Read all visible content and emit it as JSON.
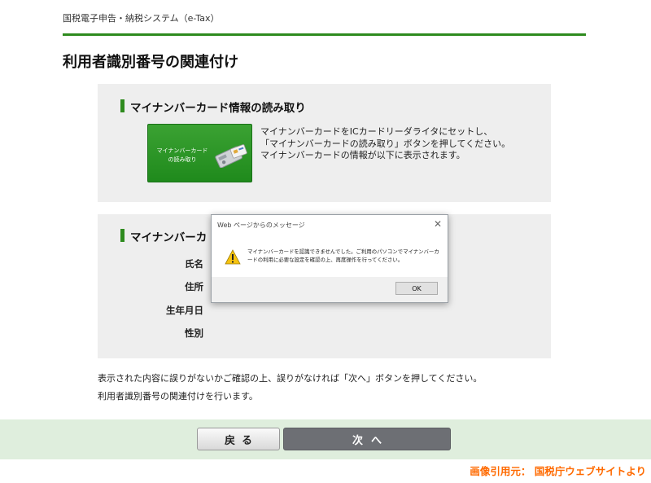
{
  "header": {
    "system_name": "国税電子申告・納税システム（e-Tax）",
    "page_title": "利用者識別番号の関連付け"
  },
  "read_section": {
    "heading": "マイナンバーカード情報の読み取り",
    "button_label_line1": "マイナンバーカード",
    "button_label_line2": "の読み取り",
    "button_icon": "card-reader-icon",
    "description": [
      "マイナンバーカードをICカードリーダライタにセットし、",
      "「マイナンバーカードの読み取り」ボタンを押してください。",
      "マイナンバーカードの情報が以下に表示されます。"
    ]
  },
  "info_section": {
    "heading": "マイナンバーカ",
    "fields": {
      "name": "氏名",
      "address": "住所",
      "birthdate": "生年月日",
      "gender": "性別"
    }
  },
  "notes": {
    "confirm": "表示された内容に誤りがないかご確認の上、誤りがなければ「次へ」ボタンを押してください。",
    "link": "利用者識別番号の関連付けを行います。"
  },
  "footer": {
    "back_label": "戻る",
    "next_label": "次へ"
  },
  "dialog": {
    "title": "Web ページからのメッセージ",
    "close_glyph": "✕",
    "icon": "warning-icon",
    "message_line1": "マイナンバーカードを認識できませんでした。ご利用のパソコンでマイナンバーカ",
    "message_line2": "ードの利用に必要な設定を確認の上、再度操作を行ってください。",
    "ok_label": "OK"
  },
  "credit": "画像引用元： 国税庁ウェブサイトより",
  "colors": {
    "accent_green": "#2e8b1e",
    "button_green": "#1f8a1c",
    "next_button_gray": "#6d6f74",
    "footer_band": "#dfeedd",
    "credit_orange": "#ff6a00"
  }
}
